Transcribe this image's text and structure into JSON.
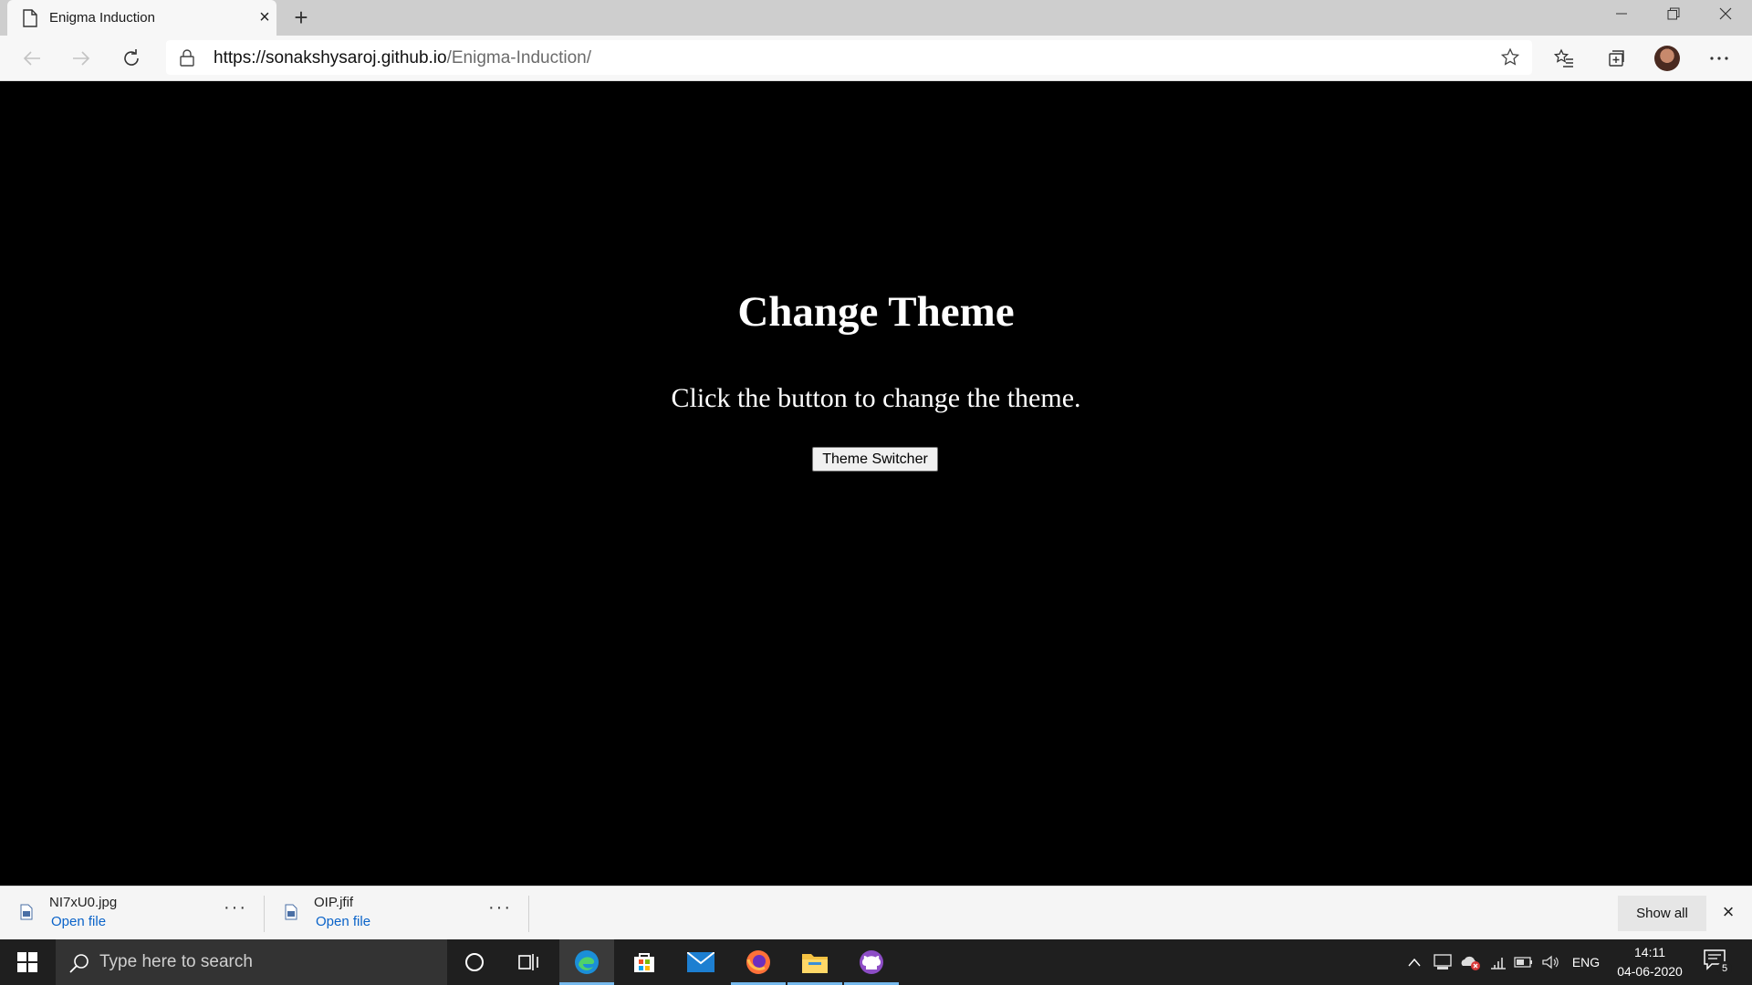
{
  "browser": {
    "tab_title": "Enigma Induction",
    "url_host": "https://sonakshysaroj.github.io",
    "url_path": "/Enigma-Induction/"
  },
  "page": {
    "heading": "Change Theme",
    "description": "Click the button to change the theme.",
    "button_label": "Theme Switcher",
    "background_color": "#000000",
    "text_color": "#ffffff"
  },
  "downloads": {
    "items": [
      {
        "filename": "NI7xU0.jpg",
        "action": "Open file"
      },
      {
        "filename": "OIP.jfif",
        "action": "Open file"
      }
    ],
    "show_all_label": "Show all"
  },
  "taskbar": {
    "search_placeholder": "Type here to search",
    "apps": [
      "cortana-icon",
      "task-view-icon",
      "edge-icon",
      "store-icon",
      "mail-icon",
      "firefox-icon",
      "file-explorer-icon",
      "github-desktop-icon"
    ],
    "language": "ENG",
    "time": "14:11",
    "date": "04-06-2020",
    "notification_count": "5"
  }
}
